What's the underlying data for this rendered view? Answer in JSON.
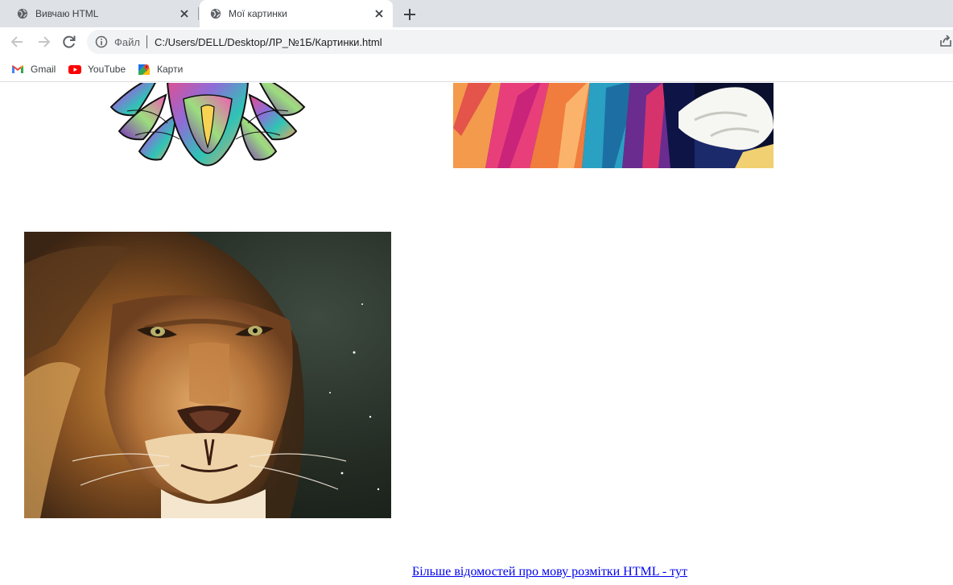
{
  "browser": {
    "tabs": [
      {
        "title": "Вивчаю HTML",
        "active": false,
        "favicon": "globe-icon"
      },
      {
        "title": "Мої картинки",
        "active": true,
        "favicon": "globe-icon"
      }
    ],
    "address_bar": {
      "scheme_label": "Файл",
      "url": "C:/Users/DELL/Desktop/ЛР_№1Б/Картинки.html"
    },
    "bookmarks": [
      {
        "label": "Gmail",
        "icon": "gmail-icon"
      },
      {
        "label": "YouTube",
        "icon": "youtube-icon"
      },
      {
        "label": "Карти",
        "icon": "maps-icon"
      }
    ]
  },
  "page": {
    "images": [
      {
        "name": "mandala-lion-image",
        "description_icon": "colorful-mandala-lion"
      },
      {
        "name": "popart-lion-image",
        "description_icon": "pop-art-lion"
      },
      {
        "name": "realistic-lion-image",
        "description_icon": "lion-painting"
      }
    ],
    "link": {
      "text": "Більше відомостей про мову розмітки HTML - тут"
    }
  },
  "colors": {
    "tabstrip": "#dee1e6",
    "omnibox": "#f1f3f4",
    "link": "#0000ee"
  }
}
